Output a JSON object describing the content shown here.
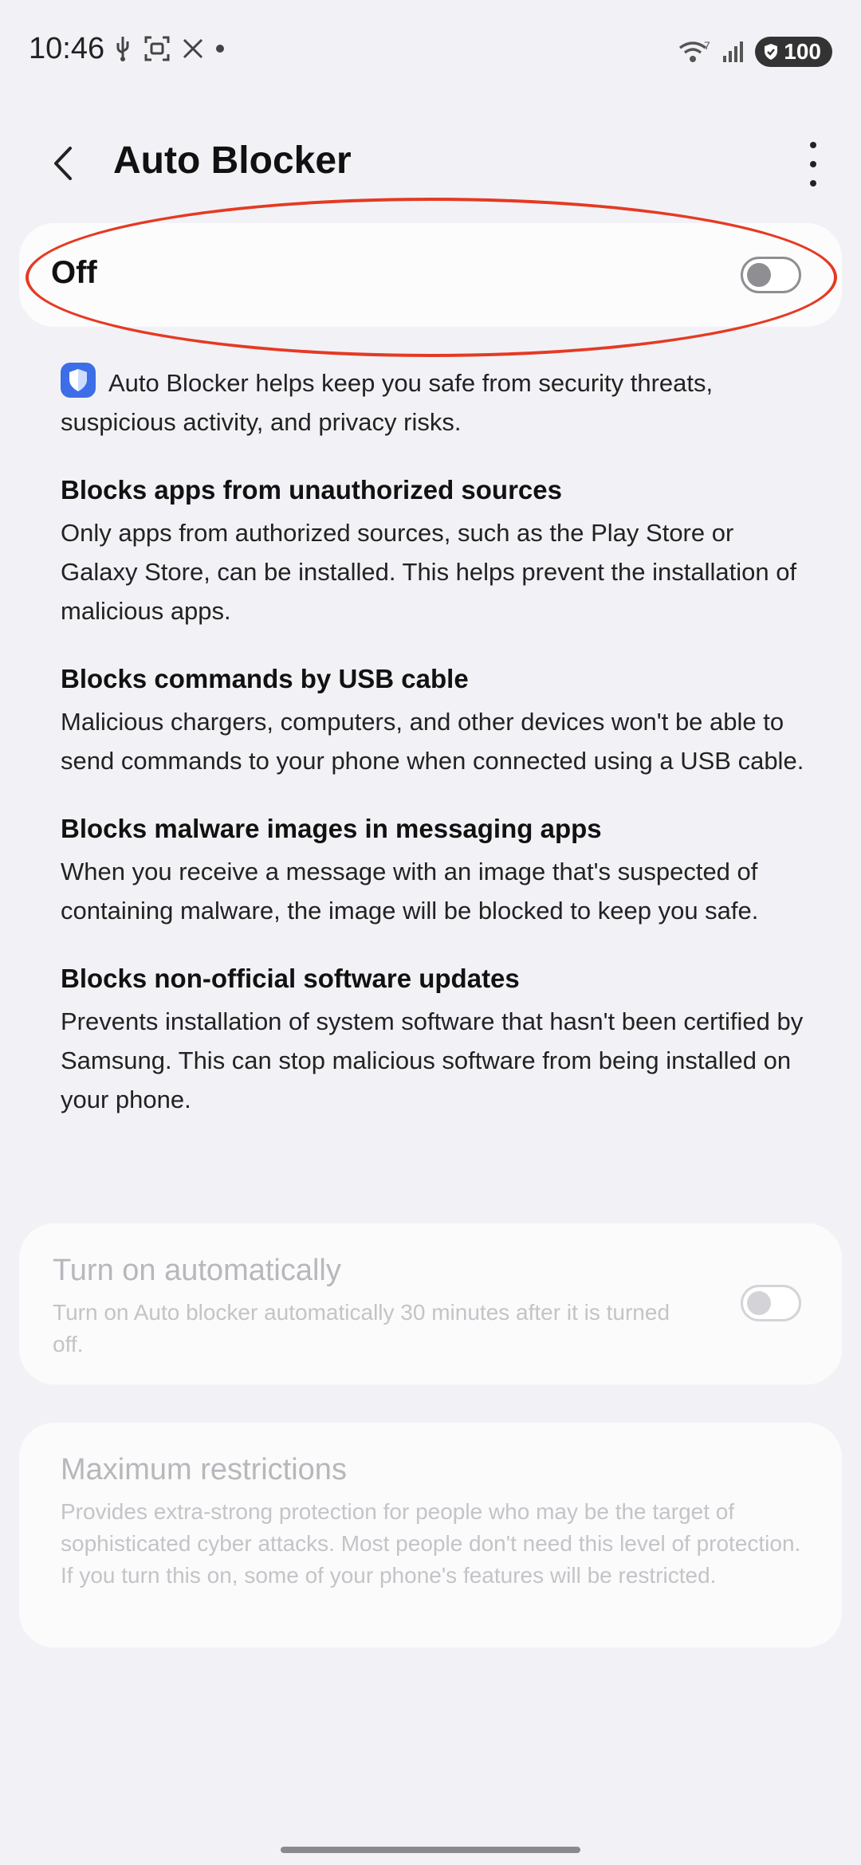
{
  "status_bar": {
    "time": "10:46",
    "left_icons": [
      "usb-icon",
      "screenshot-icon",
      "x-app-icon",
      "dot-icon"
    ],
    "right_icons": [
      "wifi-icon",
      "signal-icon",
      "battery-icon"
    ],
    "battery_level": "100"
  },
  "header": {
    "title": "Auto Blocker",
    "back_icon": "back-arrow-icon",
    "menu_icon": "more-vertical-icon"
  },
  "master_switch": {
    "label": "Off",
    "state": "off"
  },
  "intro": {
    "icon": "shield-icon",
    "text": "Auto Blocker helps keep you safe from security threats, suspicious activity, and privacy risks."
  },
  "features": [
    {
      "title": "Blocks apps from unauthorized sources",
      "description": "Only apps from authorized sources, such as the Play Store or Galaxy Store, can be installed. This helps prevent the installation of malicious apps."
    },
    {
      "title": "Blocks commands by USB cable",
      "description": "Malicious chargers, computers, and other devices won't be able to send commands to your phone when connected using a USB cable."
    },
    {
      "title": "Blocks malware images in messaging apps",
      "description": "When you receive a message with an image that's suspected of containing malware, the image will be blocked to keep you safe."
    },
    {
      "title": "Blocks non-official software updates",
      "description": "Prevents installation of system software that hasn't been certified by Samsung. This can stop malicious software from being installed on your phone."
    }
  ],
  "auto_setting": {
    "title": "Turn on automatically",
    "description": "Turn on Auto blocker automatically 30 minutes after it is turned off.",
    "state": "off",
    "enabled": false
  },
  "max_restrictions": {
    "title": "Maximum restrictions",
    "description": "Provides extra-strong protection for people who may be the target of sophisticated cyber attacks. Most people don't need this level of protection. If you turn this on, some of your phone's features will be restricted.",
    "enabled": false
  },
  "colors": {
    "background": "#f2f2f6",
    "card": "#fcfcfd",
    "highlight": "#e53a23",
    "shield_blue": "#3d6ee8"
  }
}
